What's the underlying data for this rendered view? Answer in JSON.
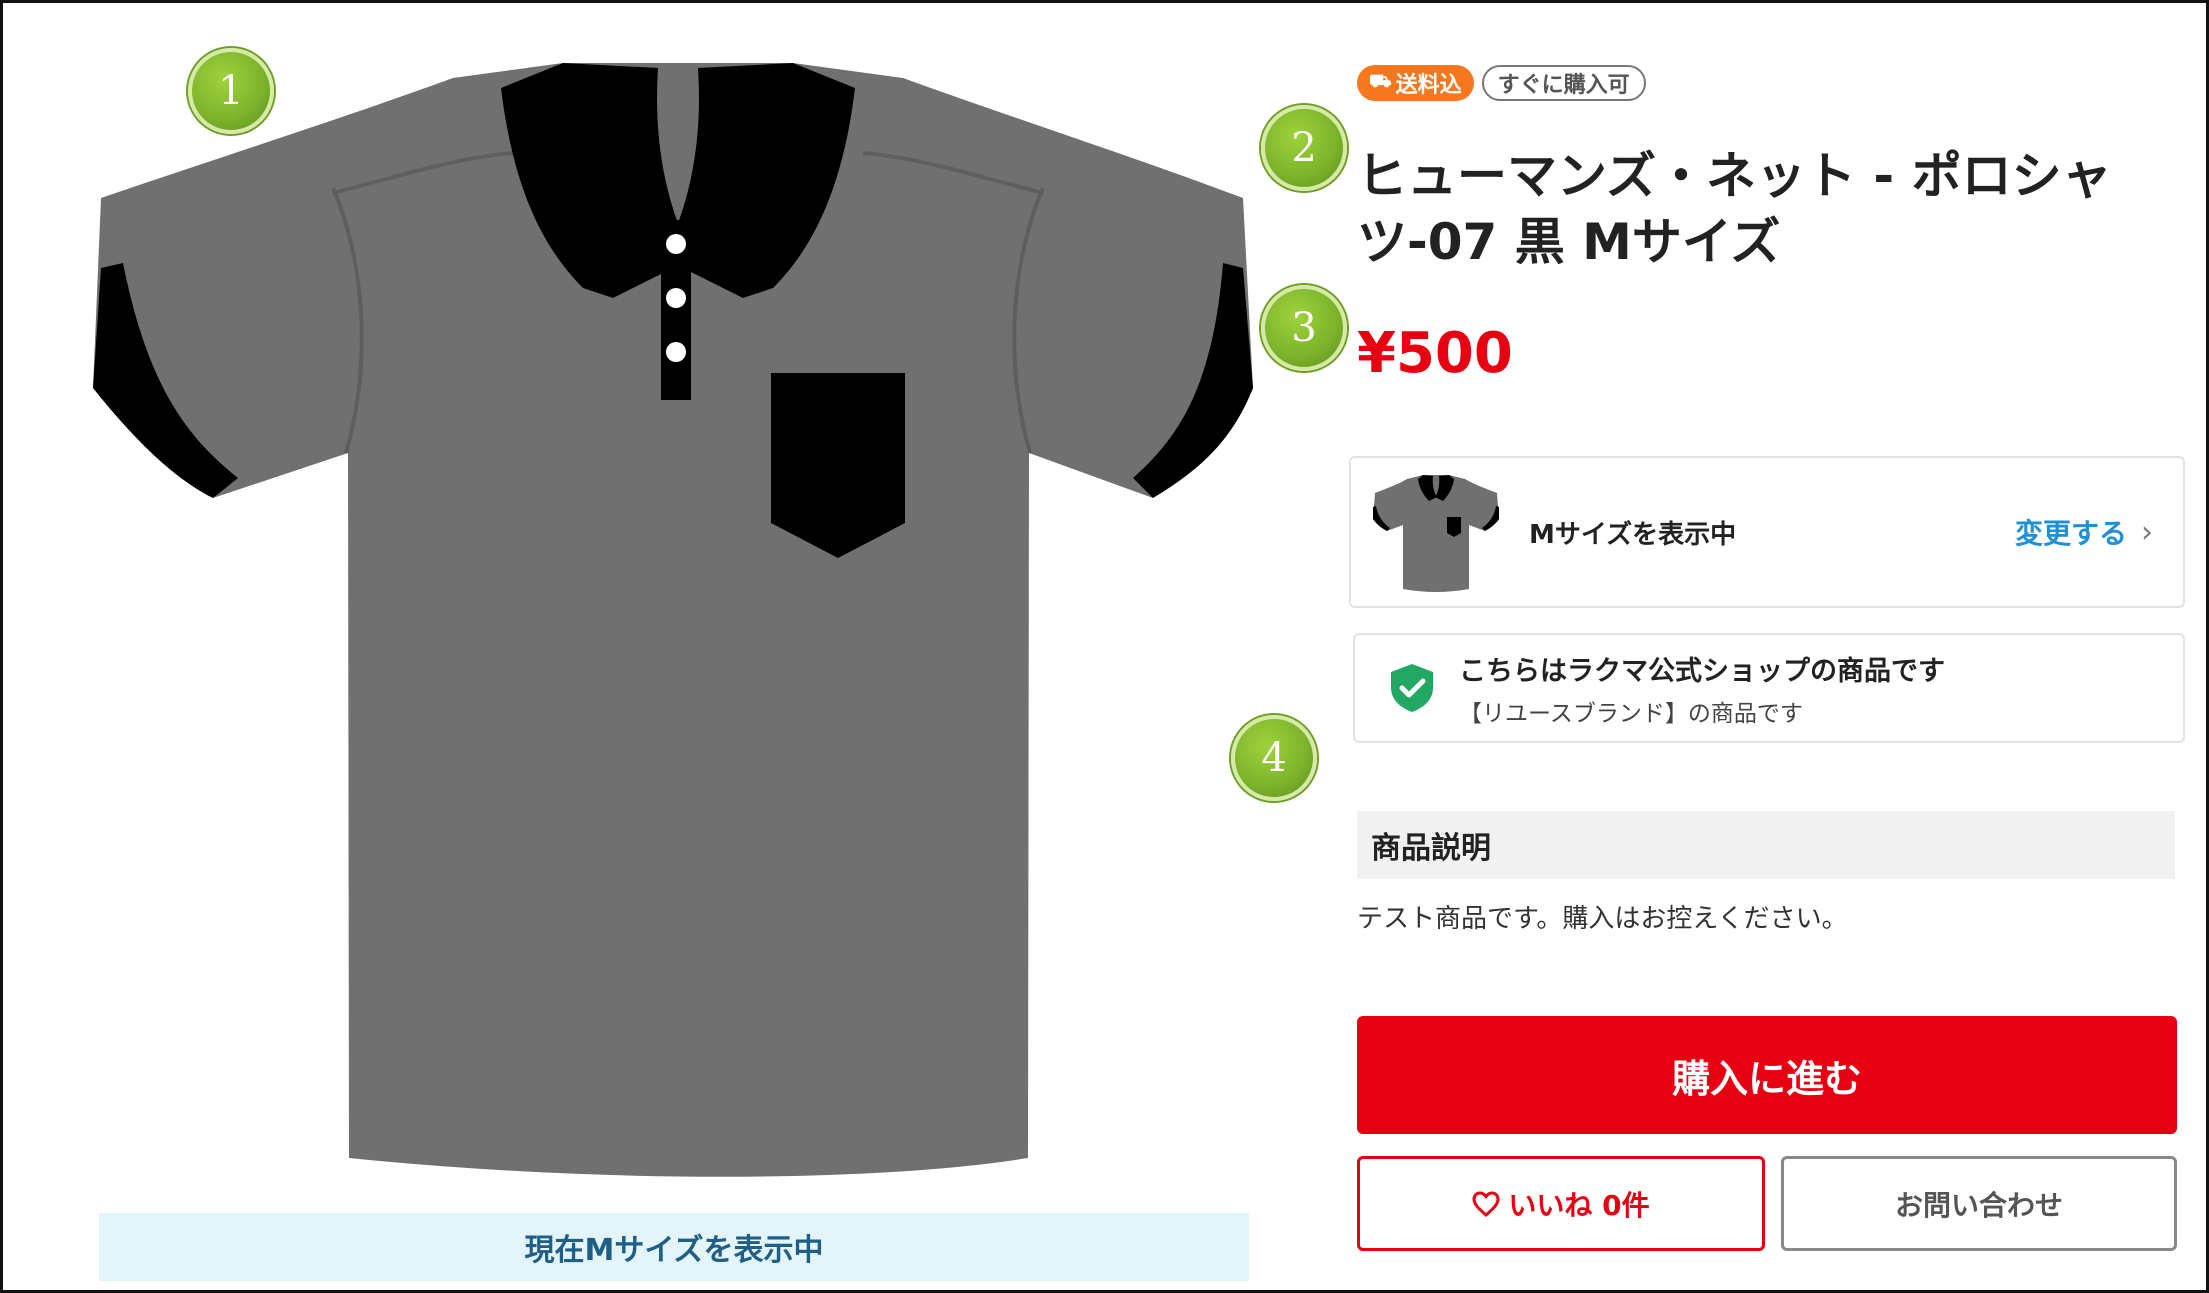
{
  "annotations": [
    "1",
    "2",
    "3",
    "4"
  ],
  "product": {
    "badges": {
      "shipping": "送料込",
      "instant_buy": "すぐに購入可"
    },
    "title": "ヒューマンズ・ネット - ポロシャツ-07 黒 Mサイズ",
    "price": "¥500",
    "image_caption": "現在Mサイズを表示中",
    "shirt_colors": {
      "body": "#707070",
      "trim": "#000000",
      "seam": "#5e5e5e",
      "button": "#ffffff"
    }
  },
  "size_card": {
    "label": "Mサイズを表示中",
    "change_link": "変更する",
    "chevron": "›"
  },
  "shop_card": {
    "icon": "shield-check-icon",
    "title": "こちらはラクマ公式ショップの商品です",
    "subtitle": "【リユースブランド】の商品です"
  },
  "description": {
    "heading": "商品説明",
    "body": "テスト商品です。購入はお控えください。"
  },
  "actions": {
    "buy": "購入に進む",
    "like_icon": "heart-icon",
    "like": "いいね 0件",
    "contact": "お問い合わせ"
  },
  "colors": {
    "accent_red": "#e60012",
    "link_blue": "#1f8fd6",
    "shipping_orange": "#f5781e",
    "banner_bg": "#e3f4fb",
    "marker_green": "#7ab22a"
  }
}
